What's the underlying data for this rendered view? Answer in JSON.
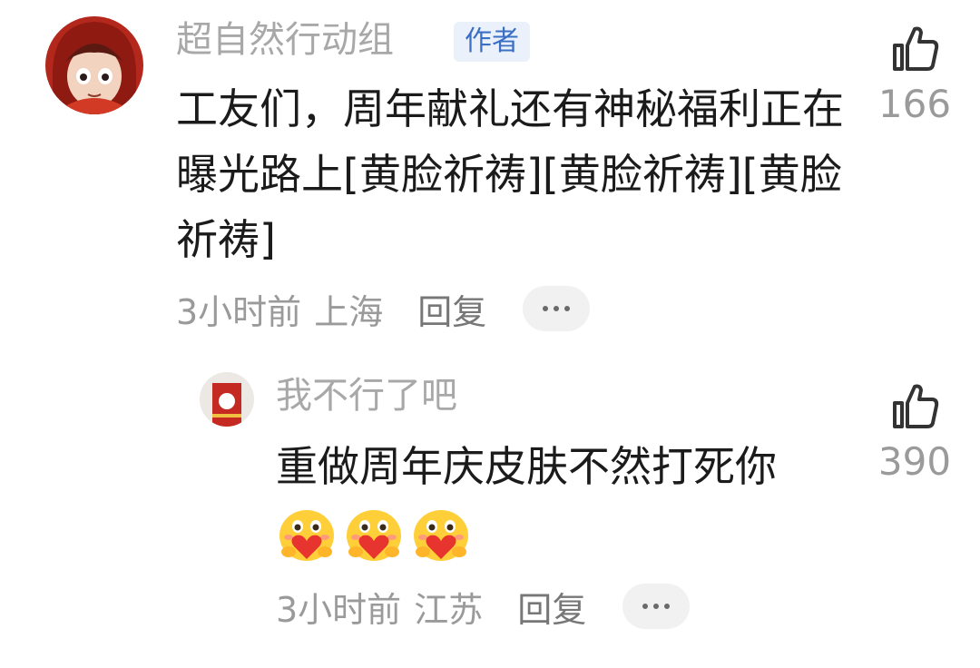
{
  "comments": [
    {
      "username": "超自然行动组",
      "badge": "作者",
      "text": "工友们，周年献礼还有神秘福利正在曝光路上[黄脸祈祷][黄脸祈祷][黄脸祈祷]",
      "time": "3小时前",
      "location": "上海",
      "reply_label": "回复",
      "likes": "166",
      "icons": {
        "like": "thumbs-up-icon",
        "more": "more-dots-icon"
      }
    },
    {
      "username": "我不行了吧",
      "text": "重做周年庆皮肤不然打死你",
      "emoji_names": [
        "heart-hug-emoji",
        "heart-hug-emoji",
        "heart-hug-emoji"
      ],
      "time": "3小时前",
      "location": "江苏",
      "reply_label": "回复",
      "likes": "390",
      "icons": {
        "like": "thumbs-up-icon",
        "more": "more-dots-icon"
      }
    }
  ],
  "colors": {
    "username": "#a8a8a8",
    "badge_bg": "#eaf1fb",
    "badge_text": "#3b6fc4",
    "meta": "#9a9a9a"
  }
}
